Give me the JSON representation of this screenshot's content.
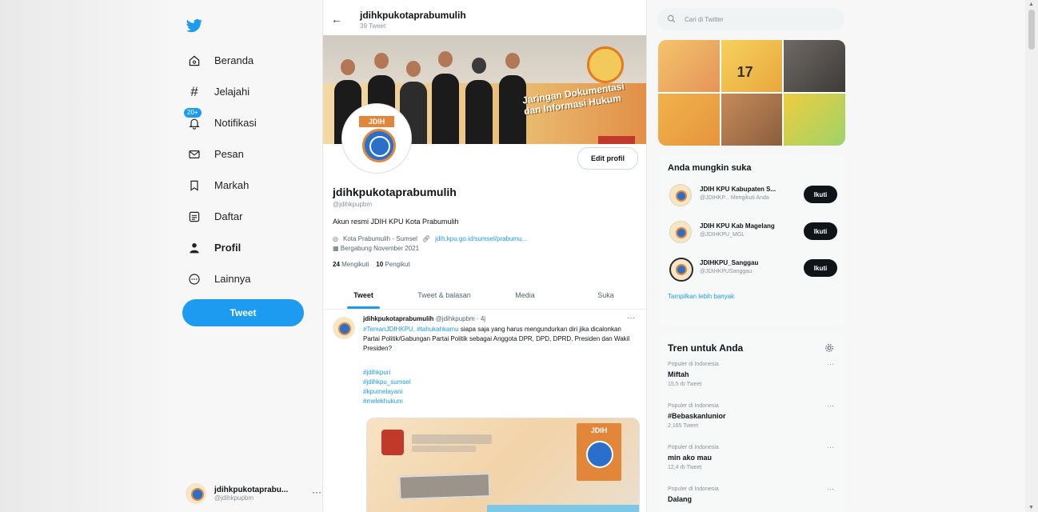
{
  "sidebar": {
    "items": [
      {
        "label": "Beranda",
        "icon": "home-icon"
      },
      {
        "label": "Jelajahi",
        "icon": "hashtag-icon"
      },
      {
        "label": "Notifikasi",
        "icon": "bell-icon",
        "badge": "20+"
      },
      {
        "label": "Pesan",
        "icon": "envelope-icon"
      },
      {
        "label": "Markah",
        "icon": "bookmark-icon"
      },
      {
        "label": "Daftar",
        "icon": "list-icon"
      },
      {
        "label": "Profil",
        "icon": "person-icon"
      },
      {
        "label": "Lainnya",
        "icon": "more-circle-icon"
      }
    ],
    "tweet_button": "Tweet",
    "account": {
      "name": "jdihkpukotaprabu...",
      "handle": "@jdihkpupbm",
      "dots": "···"
    }
  },
  "header": {
    "back": "←",
    "name": "jdihkpukotaprabumulih",
    "sub": "39 Tweet"
  },
  "banner": {
    "title": "Jaringan Dokumentasi dan Informasi Hukum"
  },
  "profile": {
    "avatar_text": "JDIH",
    "edit_button": "Edit profil",
    "name": "jdihkpukotaprabumulih",
    "handle": "@jdihkpupbm",
    "bio": "Akun resmi JDIH KPU Kota Prabumulih",
    "location": "Kota Prabumulih - Sumsel",
    "link": "jdih.kpu.go.id/sumsel/prabumu...",
    "joined": "Bergabung November 2021",
    "following_count": "24",
    "following_label": "Mengikuti",
    "followers_count": "10",
    "followers_label": "Pengikut"
  },
  "tabs": [
    "Tweet",
    "Tweet & balasan",
    "Media",
    "Suka"
  ],
  "tweet": {
    "name": "jdihkpukotaprabumulih",
    "handle_time": "@jdihkpupbm · 4j",
    "dots": "···",
    "hashtags_inline": "#TemanJDIHKPU, #tahukahkamu",
    "text": " siapa saja yang harus mengundurkan diri jika dicalonkan Partai Politik/Gabungan Partai Politik sebagai Anggota DPR, DPD, DPRD, Presiden dan Wakil Presiden?",
    "tags": [
      "#jdihkpuri",
      "#jdihkpu_sumsel",
      "#kpumelayani",
      "#melekhukum"
    ],
    "image_label": "JDIH"
  },
  "search": {
    "placeholder": "Cari di Twitter"
  },
  "media_grid": {
    "tile_text": "17"
  },
  "who_to_follow": {
    "title": "Anda mungkin suka",
    "users": [
      {
        "name": "JDIH KPU Kabupaten S...",
        "handle": "@JDIHKP...   Mengikuti Anda",
        "button": "Ikuti"
      },
      {
        "name": "JDIH KPU Kab Magelang",
        "handle": "@JDIHKPU_MGL",
        "button": "Ikuti"
      },
      {
        "name": "JDIHKPU_Sanggau",
        "handle": "@JDIHKPUSanggau",
        "button": "Ikuti"
      }
    ],
    "more": "Tampilkan lebih banyak"
  },
  "trends": {
    "title": "Tren untuk Anda",
    "items": [
      {
        "context": "Populer di Indonesia",
        "name": "Miftah",
        "count": "15,5 rb Tweet",
        "dots": "···"
      },
      {
        "context": "Populer di Indonesia",
        "name": "#Bebaskanlunior",
        "count": "2.165 Tweet",
        "dots": "···"
      },
      {
        "context": "Populer di Indonesia",
        "name": "min ako mau",
        "count": "12,4 rb Tweet",
        "dots": "···"
      },
      {
        "context": "Populer di Indonesia",
        "name": "Dalang",
        "count": "",
        "dots": "···"
      }
    ]
  },
  "colors": {
    "accent": "#1d9bf0",
    "dark": "#0f1419",
    "muted": "#536471"
  }
}
